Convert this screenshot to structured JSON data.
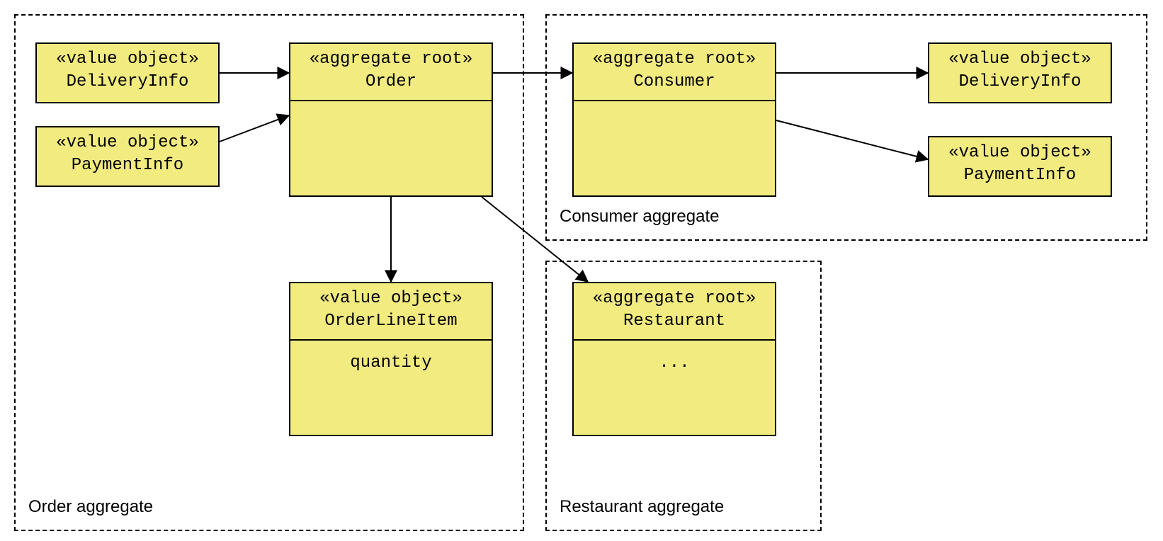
{
  "aggregates": {
    "order": {
      "label": "Order aggregate"
    },
    "consumer": {
      "label": "Consumer aggregate"
    },
    "restaurant": {
      "label": "Restaurant aggregate"
    }
  },
  "boxes": {
    "deliveryInfo1": {
      "stereo": "«value object»",
      "name": "DeliveryInfo"
    },
    "paymentInfo1": {
      "stereo": "«value object»",
      "name": "PaymentInfo"
    },
    "order": {
      "stereo": "«aggregate root»",
      "name": "Order"
    },
    "orderLineItem": {
      "stereo": "«value object»",
      "name": "OrderLineItem",
      "attr": "quantity"
    },
    "consumer": {
      "stereo": "«aggregate root»",
      "name": "Consumer"
    },
    "deliveryInfo2": {
      "stereo": "«value object»",
      "name": "DeliveryInfo"
    },
    "paymentInfo2": {
      "stereo": "«value object»",
      "name": "PaymentInfo"
    },
    "restaurant": {
      "stereo": "«aggregate root»",
      "name": "Restaurant",
      "attr": "..."
    }
  }
}
